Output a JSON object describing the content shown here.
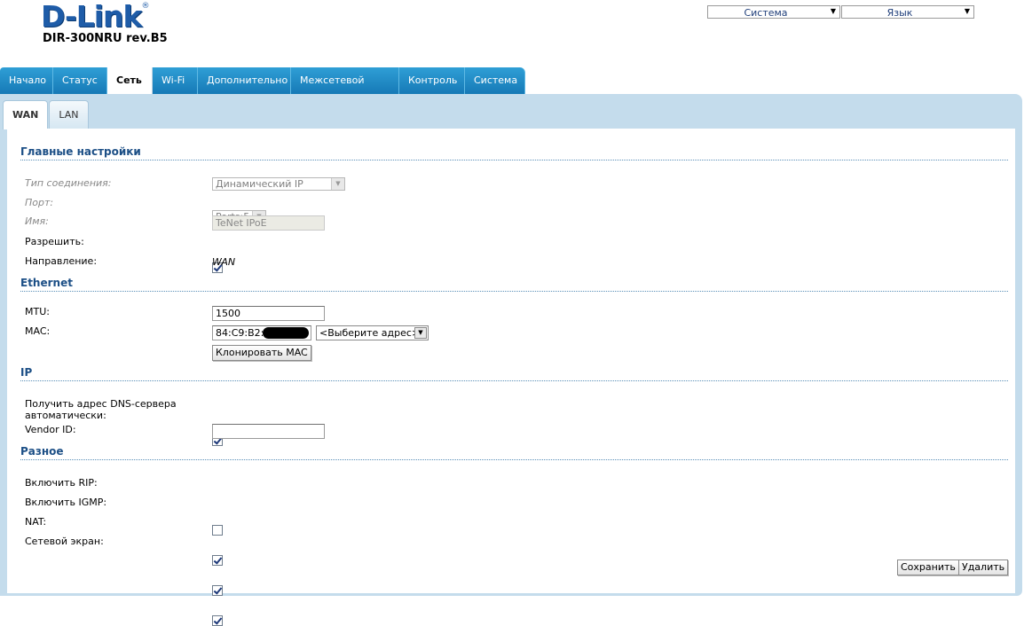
{
  "brand": {
    "logo": "D-Link",
    "registered": "®",
    "model": "DIR-300NRU rev.B5"
  },
  "top_selects": [
    {
      "label": "Система"
    },
    {
      "label": "Язык"
    }
  ],
  "nav": {
    "tabs": [
      "Начало",
      "Статус",
      "Сеть",
      "Wi-Fi",
      "Дополнительно",
      "Межсетевой экран",
      "Контроль",
      "Система"
    ],
    "active": "Сеть"
  },
  "subtabs": {
    "items": [
      "WAN",
      "LAN"
    ],
    "active": "WAN"
  },
  "sections": {
    "main": "Главные настройки",
    "ethernet": "Ethernet",
    "ip": "IP",
    "misc": "Разное"
  },
  "main": {
    "conn_type_label": "Тип соединения:",
    "conn_type_value": "Динамический IP",
    "port_label": "Порт:",
    "port_value": "Ports:5",
    "name_label": "Имя:",
    "name_value": "TeNet IPoE",
    "enable_label": "Разрешить:",
    "enable_checked": true,
    "direction_label": "Направление:",
    "direction_value": "WAN"
  },
  "ethernet": {
    "mtu_label": "MTU:",
    "mtu_value": "1500",
    "mac_label": "MAC:",
    "mac_value": "84:C9:B2:",
    "mac_select": "<Выберите адрес>",
    "clone_button": "Клонировать MAC"
  },
  "ip": {
    "dns_label_1": "Получить адрес DNS-сервера",
    "dns_label_2": "автоматически:",
    "dns_checked": true,
    "vendor_label": "Vendor ID:",
    "vendor_value": ""
  },
  "misc": {
    "rip_label": "Включить RIP:",
    "rip_checked": false,
    "igmp_label": "Включить IGMP:",
    "igmp_checked": true,
    "nat_label": "NAT:",
    "nat_checked": true,
    "firewall_label": "Сетевой экран:",
    "firewall_checked": true
  },
  "actions": {
    "save": "Сохранить",
    "delete": "Удалить"
  },
  "colors": {
    "nav_blue": "#1e8fce",
    "panel": "#c4dcec",
    "section_text": "#1c4f86"
  }
}
